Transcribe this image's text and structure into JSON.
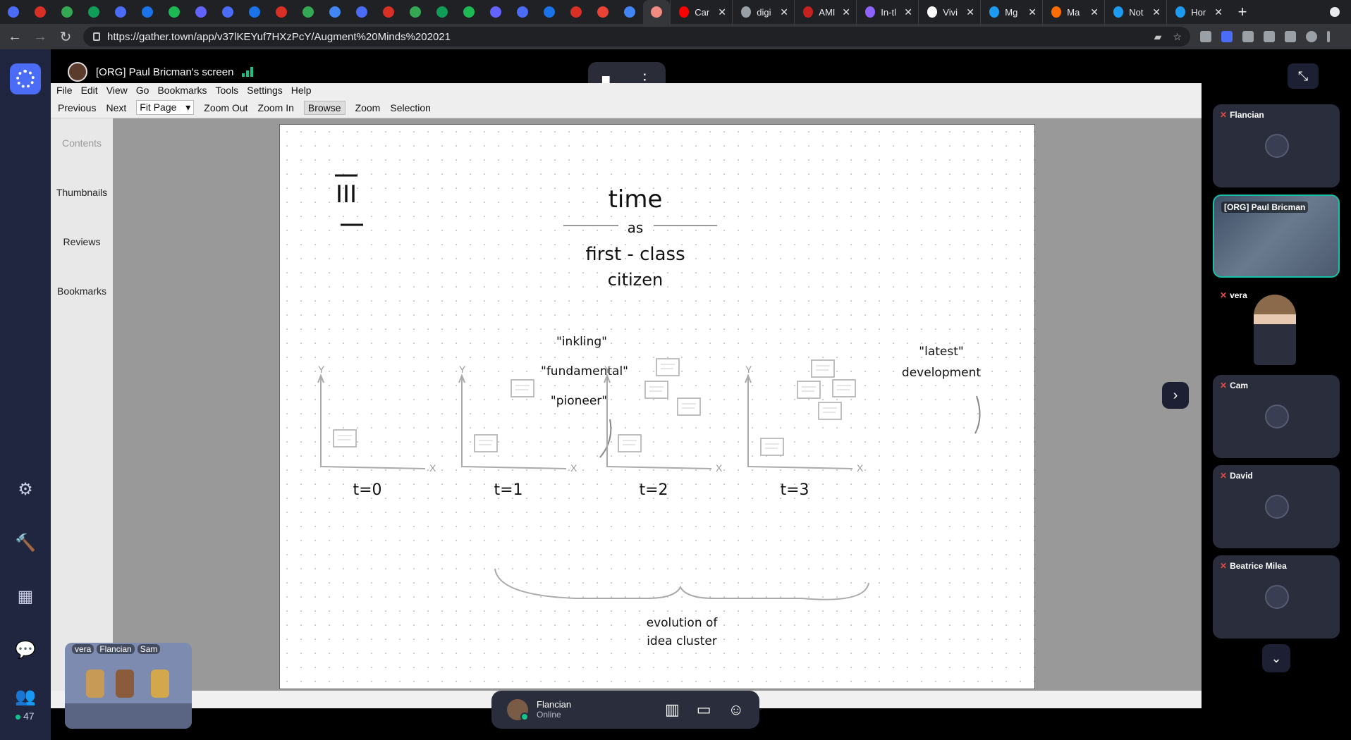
{
  "browser": {
    "pinned_tabs": [
      {
        "icon": "gather-icon",
        "color": "#4a6cf7"
      },
      {
        "icon": "mp-icon",
        "color": "#d93025"
      },
      {
        "icon": "chrome-icon",
        "color": "#34a853"
      },
      {
        "icon": "green-app-icon",
        "color": "#0f9d58"
      },
      {
        "icon": "gather-icon",
        "color": "#4a6cf7"
      },
      {
        "icon": "bluesky-icon",
        "color": "#1a73e8"
      },
      {
        "icon": "spotify-icon",
        "color": "#1db954"
      },
      {
        "icon": "mastodon-icon",
        "color": "#6364ff"
      },
      {
        "icon": "gather-icon",
        "color": "#4a6cf7"
      },
      {
        "icon": "bluesky-icon",
        "color": "#1a73e8"
      },
      {
        "icon": "mp-icon",
        "color": "#d93025"
      },
      {
        "icon": "chrome-icon",
        "color": "#34a853"
      },
      {
        "icon": "doc-icon",
        "color": "#4285f4"
      },
      {
        "icon": "gather-icon",
        "color": "#4a6cf7"
      },
      {
        "icon": "mp-icon",
        "color": "#d93025"
      },
      {
        "icon": "chrome-icon",
        "color": "#34a853"
      },
      {
        "icon": "green-app-icon",
        "color": "#0f9d58"
      },
      {
        "icon": "spotify-icon",
        "color": "#1db954"
      },
      {
        "icon": "mastodon-icon",
        "color": "#6364ff"
      },
      {
        "icon": "gather-icon",
        "color": "#4a6cf7"
      },
      {
        "icon": "bluesky-icon",
        "color": "#1a73e8"
      },
      {
        "icon": "mp-icon",
        "color": "#d93025"
      },
      {
        "icon": "gmail-icon",
        "color": "#ea4335"
      },
      {
        "icon": "doc-icon",
        "color": "#4285f4"
      },
      {
        "icon": "record-icon",
        "color": "#f28b82"
      }
    ],
    "titled_tabs": [
      {
        "title": "Car",
        "icon": "youtube-icon",
        "color": "#ff0000"
      },
      {
        "title": "digi",
        "icon": "doc-icon",
        "color": "#9aa0a6"
      },
      {
        "title": "AMI",
        "icon": "hp-icon",
        "color": "#c5221f"
      },
      {
        "title": "In-tl",
        "icon": "pen-icon",
        "color": "#8e63ff"
      },
      {
        "title": "Vivi",
        "icon": "circle-icon",
        "color": "#ffffff"
      },
      {
        "title": "Mg",
        "icon": "twitter-icon",
        "color": "#1d9bf0"
      },
      {
        "title": "Ma",
        "icon": "medium-icon",
        "color": "#ff6d00"
      },
      {
        "title": "Not",
        "icon": "twitter-icon",
        "color": "#1d9bf0"
      },
      {
        "title": "Hor",
        "icon": "twitter-icon",
        "color": "#1d9bf0"
      }
    ],
    "close_glyph": "✕",
    "new_tab_glyph": "+",
    "url": "https://gather.town/app/v37lKEYuf7HXzPcY/Augment%20Minds%202021"
  },
  "share": {
    "title": "[ORG] Paul Bricman's screen"
  },
  "pdf": {
    "menu": [
      "File",
      "Edit",
      "View",
      "Go",
      "Bookmarks",
      "Tools",
      "Settings",
      "Help"
    ],
    "toolbar": {
      "previous": "Previous",
      "next": "Next",
      "fit": "Fit Page",
      "zoom_out": "Zoom Out",
      "zoom_in": "Zoom In",
      "browse": "Browse",
      "zoom": "Zoom",
      "selection": "Selection"
    },
    "sidebar": [
      "Contents",
      "Thumbnails",
      "Reviews",
      "Bookmarks"
    ],
    "page": {
      "number": "III",
      "title_lines": [
        "time",
        "as",
        "first - class",
        "citizen"
      ],
      "left_quotes": [
        "\"inkling\"",
        "\"fundamental\"",
        "\"pioneer\""
      ],
      "right_quote": [
        "\"latest\"",
        "development"
      ],
      "axis_y": "Y",
      "axis_x": "X",
      "time_labels": [
        "t=0",
        "t=1",
        "t=2",
        "t=3"
      ],
      "caption": [
        "evolution of",
        "idea cluster"
      ]
    }
  },
  "status": {
    "name": "Flancian",
    "state": "Online"
  },
  "minimap": {
    "names": [
      "vera",
      "Flancian",
      "Sam"
    ]
  },
  "participants": [
    {
      "name": "Flancian",
      "kind": "avatar"
    },
    {
      "name": "[ORG] Paul Bricman",
      "kind": "video"
    },
    {
      "name": "vera",
      "kind": "figure"
    },
    {
      "name": "Cam",
      "kind": "avatar"
    },
    {
      "name": "David",
      "kind": "avatar"
    },
    {
      "name": "Beatrice Milea",
      "kind": "avatar"
    }
  ],
  "online_count": "47",
  "colors": {
    "accent": "#4a6cf7",
    "online": "#14c28a",
    "muted": "#e24b4b",
    "rail": "#202540"
  }
}
